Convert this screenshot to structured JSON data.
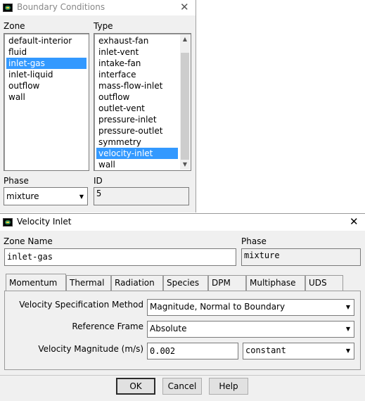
{
  "bc": {
    "title": "Boundary Conditions",
    "zone_label": "Zone",
    "type_label": "Type",
    "zones": [
      "default-interior",
      "fluid",
      "inlet-gas",
      "inlet-liquid",
      "outflow",
      "wall"
    ],
    "types": [
      "exhaust-fan",
      "inlet-vent",
      "intake-fan",
      "interface",
      "mass-flow-inlet",
      "outflow",
      "outlet-vent",
      "pressure-inlet",
      "pressure-outlet",
      "symmetry",
      "velocity-inlet",
      "wall"
    ],
    "phase_label": "Phase",
    "phase_value": "mixture",
    "id_label": "ID",
    "id_value": "5"
  },
  "vi": {
    "title": "Velocity Inlet",
    "zone_name_label": "Zone Name",
    "zone_name_value": "inlet-gas",
    "phase_label": "Phase",
    "phase_value": "mixture",
    "tabs": [
      "Momentum",
      "Thermal",
      "Radiation",
      "Species",
      "DPM",
      "Multiphase",
      "UDS"
    ],
    "velocity_spec_label": "Velocity Specification Method",
    "velocity_spec_value": "Magnitude, Normal to Boundary",
    "ref_frame_label": "Reference Frame",
    "ref_frame_value": "Absolute",
    "vel_mag_label": "Velocity Magnitude (m/s)",
    "vel_mag_value": "0.002",
    "vel_mag_profile": "constant",
    "ok_label": "OK",
    "cancel_label": "Cancel",
    "help_label": "Help"
  },
  "selection": {
    "zone_index": 2,
    "type_index": 10
  },
  "colors": {
    "selection": "#3399ff",
    "dialog_bg": "#f0f0f0",
    "titlebar_bg": "#ffffff"
  },
  "icons": {
    "window": "fluent-window-icon",
    "close": "close-icon",
    "dropdown": "chevron-down-icon"
  }
}
